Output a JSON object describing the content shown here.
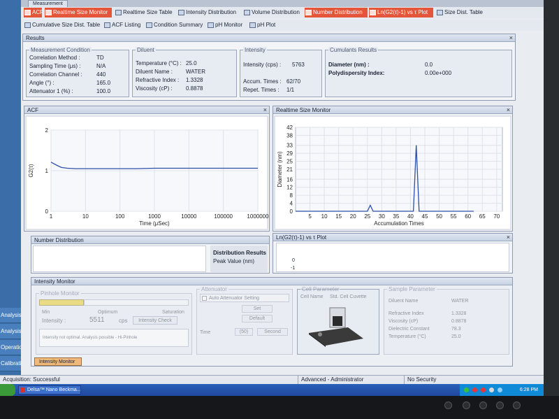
{
  "window": {
    "top_tab": "Measurement"
  },
  "toolbar_row1": [
    {
      "label": "ACF",
      "icon": "acf-icon",
      "active": true
    },
    {
      "label": "Realtime Size Monitor",
      "icon": "monitor-icon",
      "active": true
    },
    {
      "label": "Realtime Size Table",
      "icon": "table-icon",
      "active": false
    },
    {
      "label": "Intensity Distribution",
      "icon": "histogram-icon",
      "active": false
    },
    {
      "label": "Volume Distribution",
      "icon": "histogram-icon",
      "active": false
    },
    {
      "label": "Number Distribution",
      "icon": "histogram-icon",
      "active": true
    },
    {
      "label": "Ln(G2(τ)-1) vs τ Plot",
      "icon": "plot-icon",
      "active": true
    },
    {
      "label": "Size Dist. Table",
      "icon": "table-icon",
      "active": false
    }
  ],
  "toolbar_row2": [
    {
      "label": "Cumulative Size Dist. Table",
      "icon": "table-icon"
    },
    {
      "label": "ACF Listing",
      "icon": "list-icon"
    },
    {
      "label": "Condition Summary",
      "icon": "summary-icon"
    },
    {
      "label": "pH Monitor",
      "icon": "ph-icon"
    },
    {
      "label": "pH Plot",
      "icon": "ph-icon"
    }
  ],
  "results": {
    "title": "Results",
    "measurement_condition": {
      "title": "Measurement Condition",
      "rows": [
        {
          "label": "Correlation Method :",
          "value": "TD"
        },
        {
          "label": "Sampling Time (μs) :",
          "value": "N/A"
        },
        {
          "label": "Correlation Channel :",
          "value": "440"
        },
        {
          "label": "Angle (°) :",
          "value": "165.0"
        },
        {
          "label": "Attenuator 1 (%) :",
          "value": "100.0"
        }
      ]
    },
    "diluent": {
      "title": "Diluent",
      "rows": [
        {
          "label": "Temperature (°C) :",
          "value": "25.0"
        },
        {
          "label": "Diluent Name :",
          "value": "WATER"
        },
        {
          "label": "Refractive Index :",
          "value": "1.3328"
        },
        {
          "label": "Viscosity (cP) :",
          "value": "0.8878"
        }
      ]
    },
    "intensity": {
      "title": "Intensity",
      "intensity_label": "Intensity (cps) :",
      "intensity_value": "5763",
      "accum_label": "Accum. Times :",
      "accum_value": "62/70",
      "repet_label": "Repet. Times :",
      "repet_value": "1/1"
    },
    "cumulants": {
      "title": "Cumulants Results",
      "diameter_label": "Diameter (nm) :",
      "diameter_value": "0.0",
      "pdi_label": "Polydispersity Index:",
      "pdi_value": "0.00e+000"
    }
  },
  "acf_panel": {
    "title": "ACF"
  },
  "realtime_panel": {
    "title": "Realtime Size Monitor"
  },
  "number_panel": {
    "title": "Number Distribution",
    "dist_results": "Distribution Results",
    "peak_value": "Peak Value (nm)"
  },
  "ln_panel": {
    "title": "Ln(G2(τ)-1) vs τ Plot",
    "tick_0": "0",
    "tick_m1": "-1"
  },
  "intensity_monitor": {
    "title": "Intensity Monitor",
    "pinhole_title": "Pinhole Monitor",
    "min_label": "Min",
    "optimum_label": "Optimum",
    "saturation_label": "Saturation",
    "intensity_label": "Intensity :",
    "intensity_value": "5511",
    "intensity_unit": "cps",
    "check_button": "Intensity Check",
    "message": "Intensity not optimal. Analysis possible - Hi-Pinhole",
    "attenuator_title": "Attenuator",
    "auto_label": "Auto Attenuator Setting",
    "btn_set": "Set",
    "btn_default": "Default",
    "time_label": "Time",
    "time_value": "(50)",
    "btn_second": "Second",
    "cell_title": "Cell Parameter",
    "cell_name": "Cell Name",
    "cell_name_value": "Std. Cell Cuvette",
    "sample_title": "Sample Parameter",
    "sample_rows": [
      {
        "label": "Diluent Name",
        "value": "WATER"
      },
      {
        "label": "Refractive Index",
        "value": "1.3328"
      },
      {
        "label": "Viscosity (cP)",
        "value": "0.8878"
      },
      {
        "label": "Dielectric Constant",
        "value": "78.3"
      },
      {
        "label": "Temperature (°C)",
        "value": "25.0"
      }
    ],
    "bottom_tab": "Intensity Monitor"
  },
  "statusbar": {
    "left": "Acquisition: Successful",
    "user": "Advanced - Administrator",
    "security": "No Security"
  },
  "taskbar": {
    "app": "Delsa™ Nano Beckma...",
    "clock": "6:28 PM"
  },
  "left_strip": [
    "Analysis",
    "Analysis",
    "Operation",
    "Calibration"
  ],
  "colors": {
    "accent_red": "#e4553a",
    "plot_line": "#2d4fa8",
    "taskbar": "#2456b0"
  },
  "chart_data": [
    {
      "type": "line",
      "title": "ACF",
      "xlabel": "Time (μSec)",
      "ylabel": "G2(τ)",
      "x_scale": "log",
      "xlim": [
        1,
        1000000
      ],
      "ylim": [
        0,
        2
      ],
      "x_ticks": [
        "1",
        "10",
        "100",
        "1000",
        "10000",
        "100000",
        "1000000"
      ],
      "y_ticks": [
        "0",
        "1",
        "2"
      ],
      "series": [
        {
          "x": [
            1,
            1.5,
            2,
            3,
            5,
            10,
            30,
            100,
            300,
            1000,
            3000,
            10000,
            30000,
            100000,
            300000,
            1000000
          ],
          "y": [
            1.21,
            1.13,
            1.08,
            1.06,
            1.05,
            1.05,
            1.05,
            1.05,
            1.05,
            1.06,
            1.06,
            1.06,
            1.06,
            1.06,
            1.06,
            1.06
          ]
        }
      ]
    },
    {
      "type": "line",
      "title": "Realtime Size Monitor",
      "xlabel": "Accumulation Times",
      "ylabel": "Diameter (nm)",
      "xlim": [
        0,
        72
      ],
      "ylim": [
        0,
        42
      ],
      "x_ticks": [
        "5",
        "10",
        "15",
        "20",
        "25",
        "30",
        "35",
        "40",
        "45",
        "50",
        "55",
        "60",
        "65",
        "70"
      ],
      "y_ticks": [
        "0",
        "4",
        "8",
        "12",
        "16",
        "21",
        "25",
        "29",
        "33",
        "38",
        "42"
      ],
      "series": [
        {
          "x": [
            0,
            25,
            26,
            27,
            41,
            42,
            43,
            44,
            62
          ],
          "y": [
            0,
            0,
            3,
            0,
            0,
            33,
            0,
            0,
            0
          ]
        }
      ]
    }
  ]
}
